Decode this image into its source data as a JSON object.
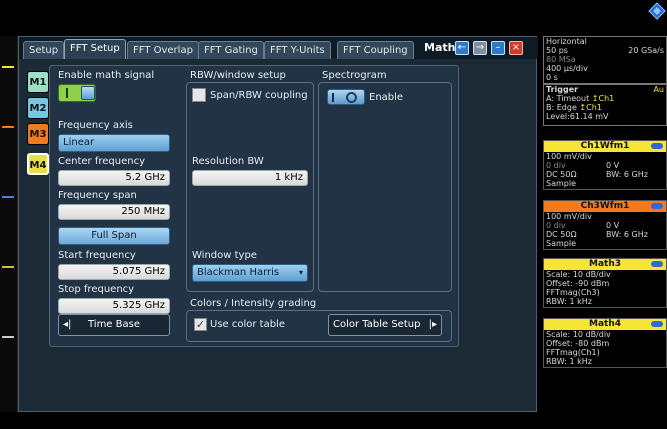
{
  "tabs": [
    "Setup",
    "FFT Setup",
    "FFT Overlap",
    "FFT Gating",
    "FFT Y-Units",
    "FFT Coupling"
  ],
  "dialog_title": "Math",
  "math_tabs": [
    "M1",
    "M2",
    "M3",
    "M4"
  ],
  "labels": {
    "enable_math": "Enable math signal",
    "freq_axis": "Frequency axis",
    "center_freq": "Center frequency",
    "freq_span": "Frequency span",
    "start_freq": "Start frequency",
    "stop_freq": "Stop frequency",
    "rbw_setup": "RBW/window setup",
    "span_rbw_coupling": "Span/RBW coupling",
    "resolution_bw": "Resolution BW",
    "window_type": "Window type",
    "spectrogram": "Spectrogram",
    "enable": "Enable",
    "colors_group": "Colors / Intensity grading",
    "use_color_table": "Use color table"
  },
  "values": {
    "freq_axis": "Linear",
    "center_freq": "5.2 GHz",
    "freq_span": "250 MHz",
    "start_freq": "5.075 GHz",
    "stop_freq": "5.325 GHz",
    "resolution_bw": "1 kHz",
    "window_type": "Blackman Harris"
  },
  "buttons": {
    "full_span": "Full Span",
    "time_base": "Time Base",
    "color_table_setup": "Color Table Setup"
  },
  "right": {
    "horizontal": {
      "title": "Horizontal",
      "line1_left": "50 ps",
      "line1_right": "20 GSa/s",
      "line2": "80 MSa",
      "line3": "400 µs/div",
      "line4": "0 s"
    },
    "trigger": {
      "title": "Trigger",
      "title_right": "Au",
      "lineA": "A:   Timeout",
      "lineA_ch": "Ch1",
      "lineB": "B:   Edge",
      "lineB_ch": "Ch1",
      "level": "Level:61.14 mV"
    },
    "ch1": {
      "title": "Ch1Wfm1",
      "l1": "100 mV/div",
      "l2a": "0 div",
      "l2b": "0 V",
      "l3a": "DC 50Ω",
      "l3b": "BW: 6 GHz",
      "l4": "Sample"
    },
    "ch3": {
      "title": "Ch3Wfm1",
      "l1": "100 mV/div",
      "l2a": "0 div",
      "l2b": "0 V",
      "l3a": "DC 50Ω",
      "l3b": "BW: 6 GHz",
      "l4": "Sample"
    },
    "math3": {
      "title": "Math3",
      "l1": "Scale: 10 dB/div",
      "l2": "Offset: -90 dBm",
      "l3": "FFTmag(Ch3)",
      "l4": "RBW: 1 kHz"
    },
    "math4": {
      "title": "Math4",
      "l1": "Scale: 10 dB/div",
      "l2": "Offset: -80 dBm",
      "l3": "FFTmag(Ch1)",
      "l4": "RBW: 1 kHz"
    }
  },
  "colors": {
    "ch1": "#f5e536",
    "ch3": "#f47a1c",
    "math": "#f5e536",
    "m1": "#9be0c6",
    "m2": "#78c8e4",
    "m3": "#f07a22",
    "m4": "#e8e04a"
  }
}
